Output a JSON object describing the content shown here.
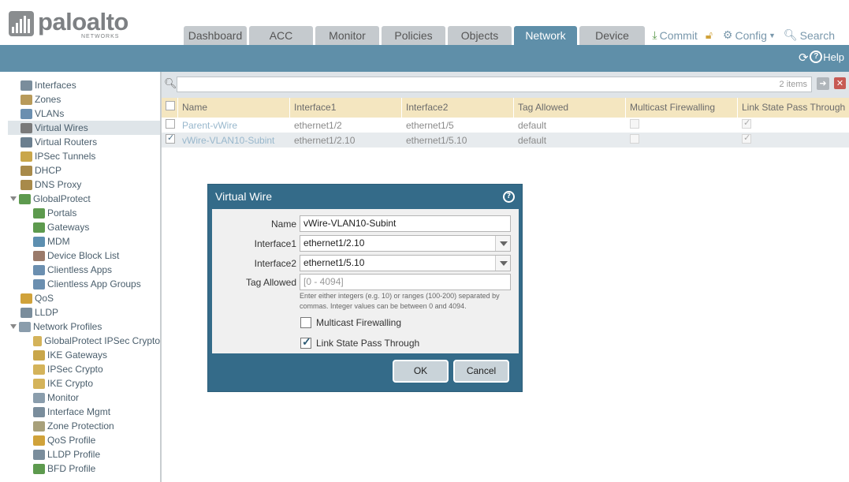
{
  "brand": {
    "name": "paloalto",
    "subtitle": "NETWORKS"
  },
  "tabs": [
    {
      "label": "Dashboard",
      "active": false
    },
    {
      "label": "ACC",
      "active": false
    },
    {
      "label": "Monitor",
      "active": false
    },
    {
      "label": "Policies",
      "active": false
    },
    {
      "label": "Objects",
      "active": false
    },
    {
      "label": "Network",
      "active": true
    },
    {
      "label": "Device",
      "active": false
    }
  ],
  "toplinks": {
    "commit": "Commit",
    "config": "Config",
    "search": "Search"
  },
  "toolbar": {
    "help": "Help"
  },
  "sidebar": {
    "items": [
      {
        "label": "Interfaces",
        "icon": "interfaces-icon",
        "color": "#7a8d9c"
      },
      {
        "label": "Zones",
        "icon": "zones-icon",
        "color": "#b89a5a"
      },
      {
        "label": "VLANs",
        "icon": "vlans-icon",
        "color": "#6b8fb0"
      },
      {
        "label": "Virtual Wires",
        "icon": "virtual-wires-icon",
        "color": "#7a7a7a",
        "selected": true
      },
      {
        "label": "Virtual Routers",
        "icon": "virtual-routers-icon",
        "color": "#6b7f8f"
      },
      {
        "label": "IPSec Tunnels",
        "icon": "ipsec-tunnels-icon",
        "color": "#c9a64a"
      },
      {
        "label": "DHCP",
        "icon": "dhcp-icon",
        "color": "#a88a4a"
      },
      {
        "label": "DNS Proxy",
        "icon": "dns-proxy-icon",
        "color": "#a88a4a"
      },
      {
        "label": "GlobalProtect",
        "icon": "globalprotect-icon",
        "color": "#5d9a4e",
        "expandable": true
      },
      {
        "label": "Portals",
        "icon": "portals-icon",
        "color": "#5d9a4e"
      },
      {
        "label": "Gateways",
        "icon": "gateways-icon",
        "color": "#5d9a4e"
      },
      {
        "label": "MDM",
        "icon": "mdm-icon",
        "color": "#5d8fb0"
      },
      {
        "label": "Device Block List",
        "icon": "device-block-list-icon",
        "color": "#9a7a6a"
      },
      {
        "label": "Clientless Apps",
        "icon": "clientless-apps-icon",
        "color": "#6b8fb0"
      },
      {
        "label": "Clientless App Groups",
        "icon": "clientless-app-groups-icon",
        "color": "#6b8fb0"
      },
      {
        "label": "QoS",
        "icon": "qos-icon",
        "color": "#d0a23a"
      },
      {
        "label": "LLDP",
        "icon": "lldp-icon",
        "color": "#7a8d9c"
      },
      {
        "label": "Network Profiles",
        "icon": "network-profiles-icon",
        "color": "#8a9dac",
        "expandable": true
      },
      {
        "label": "GlobalProtect IPSec Crypto",
        "icon": "lock-icon",
        "color": "#d4b35a"
      },
      {
        "label": "IKE Gateways",
        "icon": "ike-gateways-icon",
        "color": "#c9a64a"
      },
      {
        "label": "IPSec Crypto",
        "icon": "lock-icon",
        "color": "#d4b35a"
      },
      {
        "label": "IKE Crypto",
        "icon": "lock-icon",
        "color": "#d4b35a"
      },
      {
        "label": "Monitor",
        "icon": "monitor-icon",
        "color": "#8a9dac"
      },
      {
        "label": "Interface Mgmt",
        "icon": "interface-mgmt-icon",
        "color": "#7a8d9c"
      },
      {
        "label": "Zone Protection",
        "icon": "zone-protection-icon",
        "color": "#a8a07a"
      },
      {
        "label": "QoS Profile",
        "icon": "qos-profile-icon",
        "color": "#d0a23a"
      },
      {
        "label": "LLDP Profile",
        "icon": "lldp-profile-icon",
        "color": "#7a8d9c"
      },
      {
        "label": "BFD Profile",
        "icon": "bfd-profile-icon",
        "color": "#5d9a4e"
      }
    ]
  },
  "search": {
    "count": "2 items"
  },
  "table": {
    "columns": [
      "Name",
      "Interface1",
      "Interface2",
      "Tag Allowed",
      "Multicast Firewalling",
      "Link State Pass Through"
    ],
    "rows": [
      {
        "checked": false,
        "name": "Parent-vWire",
        "if1": "ethernet1/2",
        "if2": "ethernet1/5",
        "tag": "default",
        "multicast": false,
        "link_state": true
      },
      {
        "checked": true,
        "name": "vWire-VLAN10-Subint",
        "if1": "ethernet1/2.10",
        "if2": "ethernet1/5.10",
        "tag": "default",
        "multicast": false,
        "link_state": true
      }
    ]
  },
  "dialog": {
    "title": "Virtual Wire",
    "name_label": "Name",
    "name_value": "vWire-VLAN10-Subint",
    "if1_label": "Interface1",
    "if1_value": "ethernet1/2.10",
    "if2_label": "Interface2",
    "if2_value": "ethernet1/5.10",
    "tag_label": "Tag Allowed",
    "tag_placeholder": "[0 - 4094]",
    "hint": "Enter either integers (e.g. 10) or ranges (100-200) separated by commas. Integer values can be between 0 and 4094.",
    "multicast_label": "Multicast Firewalling",
    "multicast_checked": false,
    "link_state_label": "Link State Pass Through",
    "link_state_checked": true,
    "ok": "OK",
    "cancel": "Cancel"
  },
  "colors": {
    "accent": "#5f8fa9",
    "dialog": "#346b89",
    "header_row": "#f4e6c0"
  }
}
